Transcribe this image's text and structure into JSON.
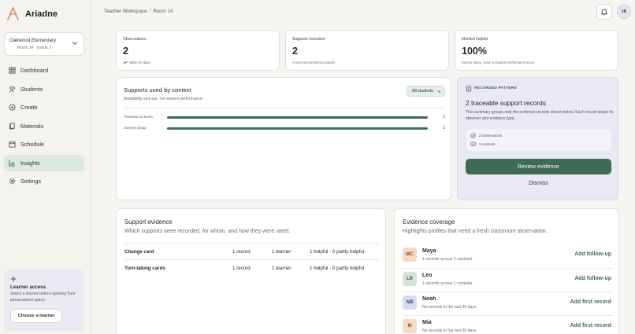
{
  "app": {
    "name": "Ariadne"
  },
  "school": {
    "name": "Oakwood Elementary",
    "sub": "Room 14 · Grade 3"
  },
  "nav": [
    {
      "label": "Dashboard",
      "icon": "grid-icon",
      "active": false
    },
    {
      "label": "Students",
      "icon": "users-icon",
      "active": false
    },
    {
      "label": "Create",
      "icon": "plus-circle-icon",
      "active": false
    },
    {
      "label": "Materials",
      "icon": "file-icon",
      "active": false
    },
    {
      "label": "Schedule",
      "icon": "calendar-icon",
      "active": false
    },
    {
      "label": "Insights",
      "icon": "bar-chart-icon",
      "active": true
    },
    {
      "label": "Settings",
      "icon": "gear-icon",
      "active": false
    }
  ],
  "learner_access": {
    "title": "Learner access",
    "desc": "Select a learner before opening their personalized space.",
    "button": "Choose a learner"
  },
  "breadcrumb": {
    "workspace": "Teacher Workspace",
    "separator": "/",
    "room": "Room 14"
  },
  "user": {
    "initials": "JR"
  },
  "stats": [
    {
      "label": "Observations",
      "value": "2",
      "sub": "within 30 days",
      "trend_icon": true
    },
    {
      "label": "Supports recorded",
      "value": "2",
      "sub": "Across documented contexts",
      "trend_icon": false
    },
    {
      "label": "Marked helpful",
      "value": "100%",
      "sub": "Source rating, never a student performance score",
      "trend_icon": false
    }
  ],
  "supports_context": {
    "title": "Supports used by context",
    "subtitle": "Availability and use, not student performance.",
    "filter": "All students",
    "rows": [
      {
        "label": "Transition to lunch",
        "value": 1,
        "fraction": 1.0
      },
      {
        "label": "Science group",
        "value": 1,
        "fraction": 1.0
      }
    ]
  },
  "pattern": {
    "eyebrow": "RECORDED PATTERN",
    "title": "2 traceable support records",
    "desc": "This summary groups only the evidence records shown below. Each record keeps its observer and evidence type.",
    "items": [
      "2 observations",
      "2 contexts"
    ],
    "primary_button": "Review evidence",
    "dismiss": "Dismiss"
  },
  "support_evidence": {
    "title": "Support evidence",
    "subtitle": "Which supports were recorded, for whom, and how they were rated.",
    "rows": [
      {
        "name": "Change card",
        "records": "1 record",
        "learners": "1 learner",
        "rating": "1 helpful · 0 partly helpful"
      },
      {
        "name": "Turn-taking cards",
        "records": "1 record",
        "learners": "1 learner",
        "rating": "1 helpful · 0 partly helpful"
      }
    ]
  },
  "coverage": {
    "title": "Evidence coverage",
    "subtitle": "Highlights profiles that need a fresh classroom observation.",
    "rows": [
      {
        "initials": "MC",
        "name": "Maya",
        "desc": "1 records across 1 contexts",
        "action": "Add follow-up",
        "bg": "#f2d8c6",
        "fg": "#8a4a24"
      },
      {
        "initials": "LR",
        "name": "Leo",
        "desc": "1 records across 1 contexts",
        "action": "Add follow-up",
        "bg": "#d3e3d8",
        "fg": "#2f5a44"
      },
      {
        "initials": "NB",
        "name": "Noah",
        "desc": "No records in the last 30 days",
        "action": "Add first record",
        "bg": "#d9dcee",
        "fg": "#3c4577"
      },
      {
        "initials": "M",
        "name": "Mia",
        "desc": "No records in the last 30 days",
        "action": "Add first record",
        "bg": "#f1dcc5",
        "fg": "#8a5524"
      }
    ]
  },
  "colors": {
    "accent": "#3f6a56",
    "active_nav": "#dbe9e2",
    "pattern_bg": "#e8e9f3"
  }
}
